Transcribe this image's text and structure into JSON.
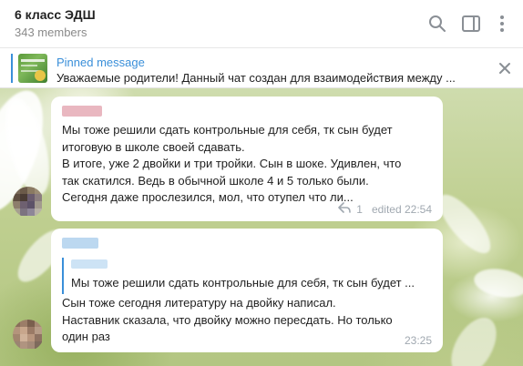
{
  "chat": {
    "title": "6 класс ЭДШ",
    "members": "343 members"
  },
  "header_icons": [
    "search-icon",
    "sidebar-toggle-icon",
    "more-vertical-icon"
  ],
  "pinned": {
    "label": "Pinned message",
    "text": "Уважаемые родители! Данный чат создан для взаимодействия между ..."
  },
  "messages": [
    {
      "lines": [
        "Мы тоже решили сдать контрольные для себя, тк сын будет",
        "итоговую в школе своей сдавать.",
        "В итоге, уже 2 двойки и три тройки. Сын в шоке. Удивлен, что",
        "так скатился. Ведь в обычной школе 4 и 5 только были.",
        "Сегодня даже прослезился, мол, что отупел что ли..."
      ],
      "replies": "1",
      "time": "edited 22:54"
    },
    {
      "quote": "Мы тоже решили сдать контрольные для себя, тк сын будет ...",
      "lines": [
        "Сын тоже сегодня литературу на двойку написал.",
        "Наставник сказала, что двойку можно пересдать. Но только",
        "один раз"
      ],
      "time": "23:25"
    }
  ],
  "colors": {
    "accent": "#3a8fd9",
    "sender1": "#e9b7c0",
    "sender2": "#bcd8f0"
  }
}
